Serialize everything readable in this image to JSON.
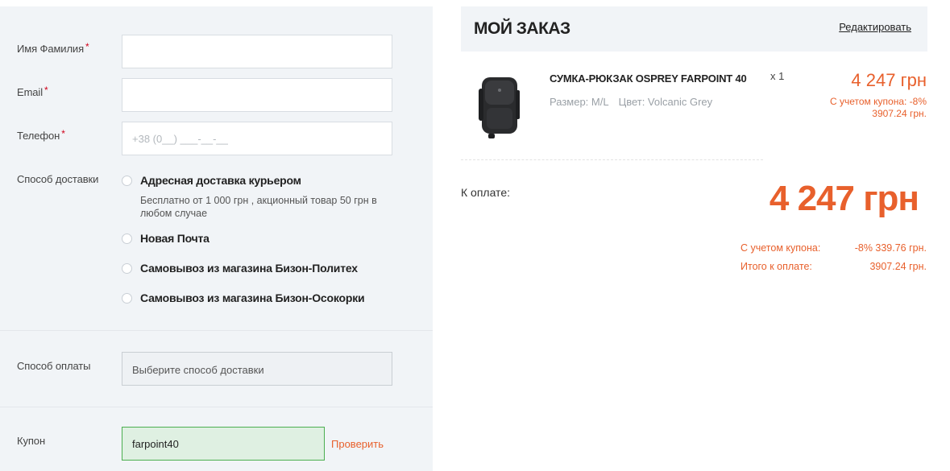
{
  "form": {
    "name_label": "Имя Фамилия",
    "email_label": "Email",
    "phone_label": "Телефон",
    "required_mark": "*",
    "phone_placeholder": "+38 (0__) ___-__-__",
    "delivery_label": "Способ доставки",
    "delivery_options": [
      {
        "label": "Адресная доставка курьером",
        "desc": "Бесплатно от 1 000 грн , акционный товар 50 грн в любом случае"
      },
      {
        "label": "Новая Почта"
      },
      {
        "label": "Самовывоз из магазина Бизон-Политех"
      },
      {
        "label": "Самовывоз из магазина Бизон-Осокорки"
      }
    ],
    "payment_label": "Способ оплаты",
    "payment_placeholder": "Выберите способ доставки",
    "coupon_label": "Купон",
    "coupon_value": "farpoint40",
    "check_label": "Проверить"
  },
  "order": {
    "title": "МОЙ ЗАКАЗ",
    "edit_label": "Редактировать",
    "item": {
      "name": "СУМКА-РЮКЗАК OSPREY FARPOINT 40",
      "size": "Размер: M/L",
      "color": "Цвет: Volcanic Grey",
      "qty": "x 1",
      "price": "4 247 грн",
      "coupon_note": "С учетом купона: -8%",
      "coupon_price": "3907.24 грн."
    },
    "to_pay_label": "К оплате:",
    "total": "4 247 грн",
    "summary": {
      "coupon_label": "С учетом купона:",
      "coupon_value": "-8% 339.76 грн.",
      "final_label": "Итого к оплате:",
      "final_value": "3907.24 грн."
    }
  },
  "colors": {
    "accent": "#e8602c",
    "panel": "#f1f4f7",
    "coupon_ok": "#4caf50"
  }
}
